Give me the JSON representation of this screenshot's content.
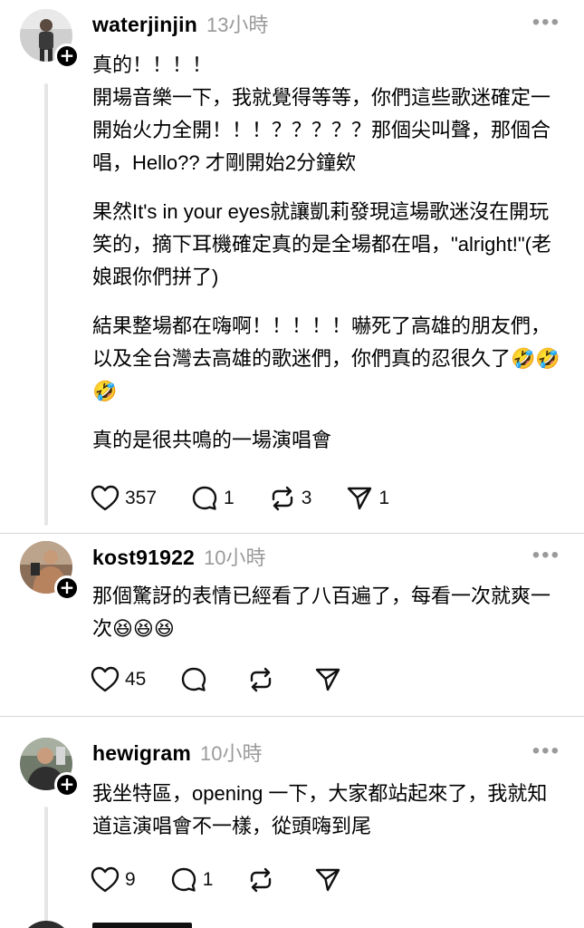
{
  "posts": [
    {
      "username": "waterjinjin",
      "time": "13小時",
      "paragraphs": [
        "真的！！！！\n開場音樂一下，我就覺得等等，你們這些歌迷確定一開始火力全開！！！？？？？？那個尖叫聲，那個合唱，Hello?? 才剛開始2分鐘欸",
        "果然It's in your eyes就讓凱莉發現這場歌迷沒在開玩笑的，摘下耳機確定真的是全場都在唱，\"alright!\"(老娘跟你們拼了)",
        "結果整場都在嗨啊！！！！！嚇死了高雄的朋友們，以及全台灣去高雄的歌迷們，你們真的忍很久了🤣🤣🤣",
        "真的是很共鳴的一場演唱會"
      ],
      "likes": "357",
      "comments": "1",
      "reposts": "3",
      "shares": "1"
    },
    {
      "username": "kost91922",
      "time": "10小時",
      "paragraphs": [
        "那個驚訝的表情已經看了八百遍了，每看一次就爽一次😆😆😆"
      ],
      "likes": "45",
      "comments": "",
      "reposts": "",
      "shares": ""
    },
    {
      "username": "hewigram",
      "time": "10小時",
      "paragraphs": [
        "我坐特區，opening 一下，大家都站起來了，我就知道這演唱會不一樣，從頭嗨到尾"
      ],
      "likes": "9",
      "comments": "1",
      "reposts": "",
      "shares": ""
    }
  ],
  "icons": {
    "more": "more-horizontal-icon",
    "like": "heart-icon",
    "comment": "comment-bubble-icon",
    "repost": "repost-arrows-icon",
    "share": "paper-plane-icon",
    "follow": "plus-icon"
  },
  "colors": {
    "text": "#000000",
    "muted": "#9a9a9a",
    "thread": "#e6e6e6",
    "divider": "#d8d8d8"
  }
}
